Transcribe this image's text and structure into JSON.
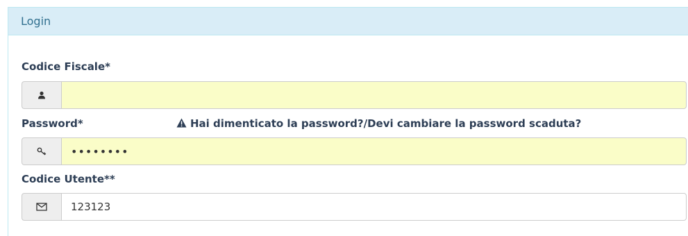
{
  "panel": {
    "title": "Login"
  },
  "fields": {
    "codice_fiscale": {
      "label": "Codice Fiscale*",
      "value": "",
      "icon": "user-icon"
    },
    "password": {
      "label": "Password*",
      "value": "12345678",
      "icon": "key-icon",
      "forgot_link": "Hai dimenticato la password?/Devi cambiare la password scaduta?",
      "forgot_icon": "warning-icon"
    },
    "codice_utente": {
      "label": "Codice Utente**",
      "value": "123123",
      "icon": "envelope-icon"
    }
  },
  "colors": {
    "heading_bg": "#d9edf7",
    "heading_text": "#31708f",
    "autofill_bg": "#fafdc8",
    "label_text": "#2d3e55"
  }
}
